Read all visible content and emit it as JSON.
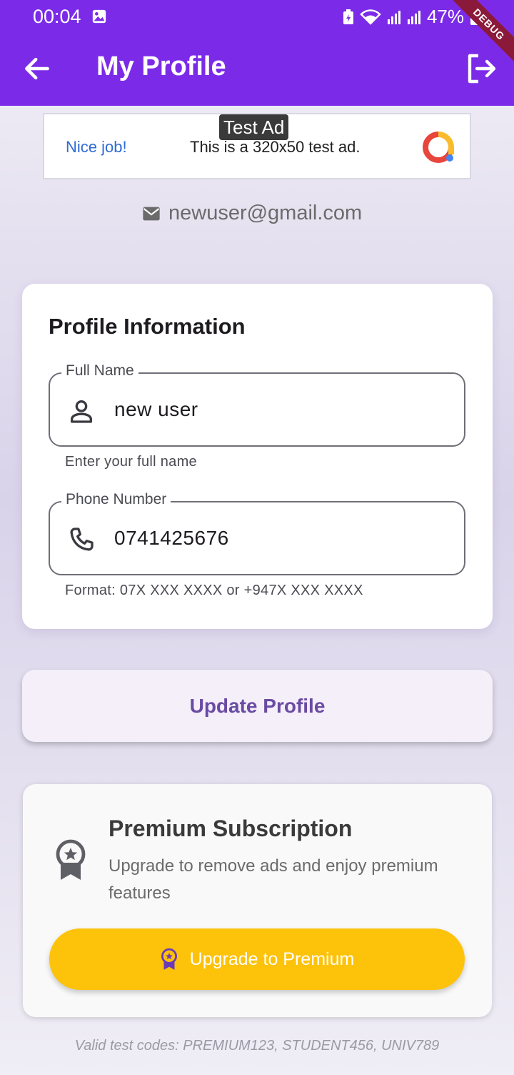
{
  "status_bar": {
    "time": "00:04",
    "battery": "47%"
  },
  "debug_label": "DEBUG",
  "appbar": {
    "title": "My Profile"
  },
  "ad": {
    "tag": "Test Ad",
    "nice": "Nice job!",
    "text": "This is a 320x50 test ad."
  },
  "user": {
    "email": "newuser@gmail.com"
  },
  "profile_card": {
    "title": "Profile Information",
    "full_name": {
      "label": "Full Name",
      "value": "new user",
      "helper": "Enter your full name"
    },
    "phone": {
      "label": "Phone Number",
      "value": "0741425676",
      "helper": "Format: 07X XXX XXXX or +947X XXX XXXX"
    }
  },
  "update_button": "Update Profile",
  "premium": {
    "title": "Premium Subscription",
    "description": "Upgrade to remove ads and enjoy premium features",
    "button": "Upgrade to Premium"
  },
  "test_codes": "Valid test codes: PREMIUM123, STUDENT456, UNIV789",
  "colors": {
    "primary": "#7b2be8",
    "accent": "#fdc20a",
    "button_text": "#6a4ba3"
  }
}
